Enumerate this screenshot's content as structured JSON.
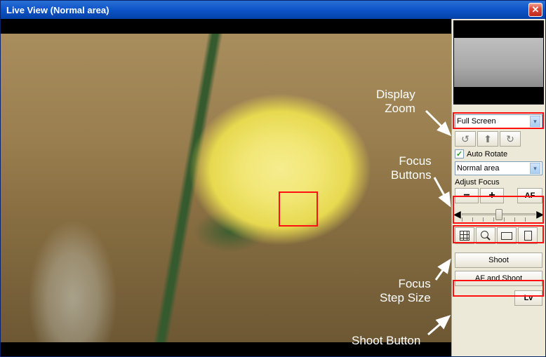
{
  "window": {
    "title": "Live View (Normal area)"
  },
  "annotations": {
    "display_zoom_1": "Display",
    "display_zoom_2": "Zoom",
    "focus_buttons_1": "Focus",
    "focus_buttons_2": "Buttons",
    "focus_step_1": "Focus",
    "focus_step_2": "Step Size",
    "shoot_button": "Shoot Button"
  },
  "controls": {
    "zoom_select": "Full Screen",
    "auto_rotate_label": "Auto Rotate",
    "area_select": "Normal area",
    "adjust_focus_label": "Adjust Focus",
    "focus_minus": "−",
    "focus_plus": "+",
    "af_label": "AF",
    "shoot_label": "Shoot",
    "af_shoot_label": "AF and Shoot",
    "lv_label": "Lv"
  }
}
